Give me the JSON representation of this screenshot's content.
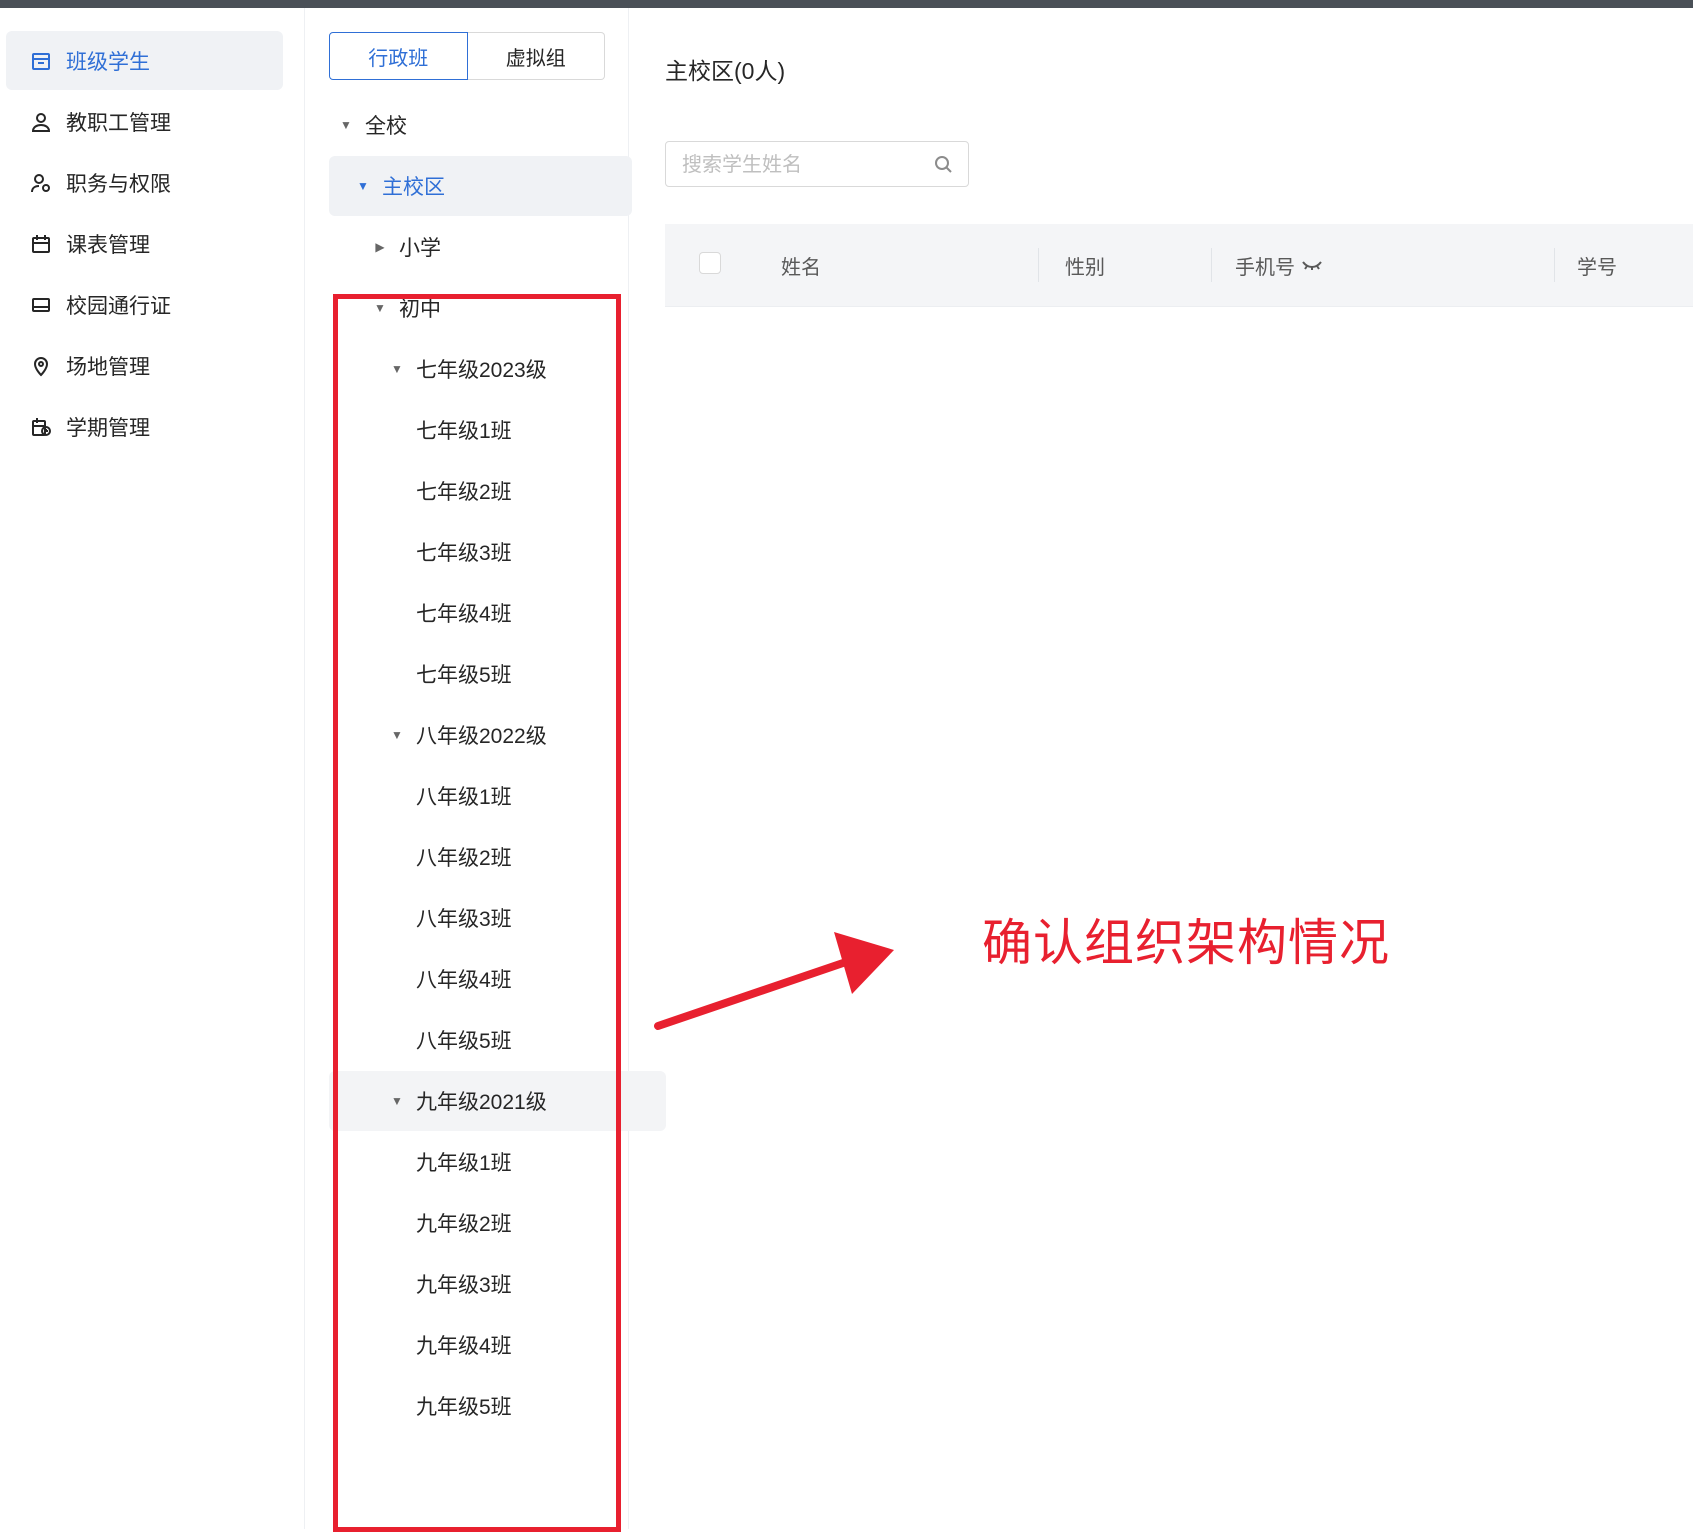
{
  "nav": {
    "items": [
      {
        "label": "班级学生",
        "icon": "class-students-icon",
        "active": true
      },
      {
        "label": "教职工管理",
        "icon": "person-icon",
        "active": false
      },
      {
        "label": "职务与权限",
        "icon": "person-key-icon",
        "active": false
      },
      {
        "label": "课表管理",
        "icon": "calendar-icon",
        "active": false
      },
      {
        "label": "校园通行证",
        "icon": "card-icon",
        "active": false
      },
      {
        "label": "场地管理",
        "icon": "location-pin-icon",
        "active": false
      },
      {
        "label": "学期管理",
        "icon": "calendar-clock-icon",
        "active": false
      }
    ]
  },
  "segment": {
    "left": "行政班",
    "right": "虚拟组",
    "active": "行政班"
  },
  "tree": {
    "nodes": [
      {
        "label": "全校",
        "caret": "down",
        "selected": false
      },
      {
        "label": "主校区",
        "caret": "down",
        "selected": true
      },
      {
        "label": "小学",
        "caret": "right",
        "selected": false
      },
      {
        "label": "初中",
        "caret": "down",
        "selected": false
      },
      {
        "label": "七年级2023级",
        "caret": "down",
        "selected": false
      },
      {
        "label": "七年级1班",
        "caret": "none",
        "selected": false
      },
      {
        "label": "七年级2班",
        "caret": "none",
        "selected": false
      },
      {
        "label": "七年级3班",
        "caret": "none",
        "selected": false
      },
      {
        "label": "七年级4班",
        "caret": "none",
        "selected": false
      },
      {
        "label": "七年级5班",
        "caret": "none",
        "selected": false
      },
      {
        "label": "八年级2022级",
        "caret": "down",
        "selected": false
      },
      {
        "label": "八年级1班",
        "caret": "none",
        "selected": false
      },
      {
        "label": "八年级2班",
        "caret": "none",
        "selected": false
      },
      {
        "label": "八年级3班",
        "caret": "none",
        "selected": false
      },
      {
        "label": "八年级4班",
        "caret": "none",
        "selected": false
      },
      {
        "label": "八年级5班",
        "caret": "none",
        "selected": false
      },
      {
        "label": "九年级2021级",
        "caret": "down",
        "selected": false,
        "hover": true
      },
      {
        "label": "九年级1班",
        "caret": "none",
        "selected": false
      },
      {
        "label": "九年级2班",
        "caret": "none",
        "selected": false
      },
      {
        "label": "九年级3班",
        "caret": "none",
        "selected": false
      },
      {
        "label": "九年级4班",
        "caret": "none",
        "selected": false
      },
      {
        "label": "九年级5班",
        "caret": "none",
        "selected": false
      }
    ]
  },
  "main": {
    "title": "主校区(0人)",
    "search_placeholder": "搜索学生姓名",
    "columns": {
      "name": "姓名",
      "gender": "性别",
      "phone": "手机号",
      "student_id": "学号"
    }
  },
  "annotation": {
    "text": "确认组织架构情况",
    "color": "#e8202f"
  },
  "colors": {
    "accent": "#2f6fd6",
    "annotation": "#e8202f"
  }
}
